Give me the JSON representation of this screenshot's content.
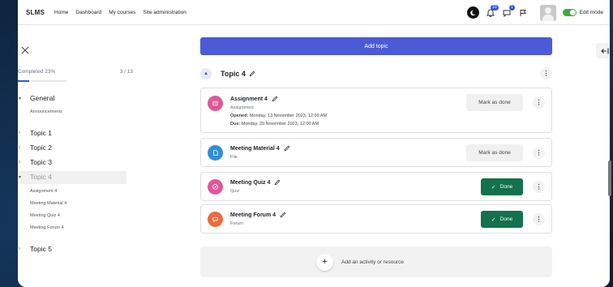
{
  "nav": {
    "brand": "SLMS",
    "links": [
      "Home",
      "Dashboard",
      "My courses",
      "Site administration"
    ],
    "notif_count": "10",
    "msg_count": "1",
    "edit_mode_label": "Edit mode",
    "edit_mode_on": true
  },
  "drawer": {
    "progress_label": "Completed 23%",
    "progress_count": "3 / 13",
    "progress_fraction": 0.23,
    "sections": [
      {
        "label": "General",
        "expanded": true,
        "children": [
          "Announcements"
        ]
      },
      {
        "label": "Topic 1",
        "expanded": false
      },
      {
        "label": "Topic 2",
        "expanded": false
      },
      {
        "label": "Topic 3",
        "expanded": false
      },
      {
        "label": "Topic 4",
        "expanded": true,
        "active": true,
        "children": [
          "Assignment 4",
          "Meeting Material 4",
          "Meeting Quiz 4",
          "Meeting Forum 4"
        ]
      },
      {
        "label": "Topic 5",
        "expanded": false
      }
    ]
  },
  "main": {
    "add_topic_label": "Add topic",
    "topic_title": "Topic 4",
    "activities": [
      {
        "title": "Assignment 4",
        "type": "Assignment",
        "opened_label": "Opened:",
        "opened": "Monday, 13 November 2023, 12:00 AM",
        "due_label": "Due:",
        "due": "Monday, 20 November 2023, 12:00 AM",
        "button": "Mark as done",
        "done": false,
        "color": "#e0589a",
        "icon": "assignment-icon"
      },
      {
        "title": "Meeting Material 4",
        "type": "File",
        "button": "Mark as done",
        "done": false,
        "color": "#2e8fd6",
        "icon": "file-icon"
      },
      {
        "title": "Meeting Quiz 4",
        "type": "Quiz",
        "button": "Done",
        "done": true,
        "color": "#e0589a",
        "icon": "quiz-icon"
      },
      {
        "title": "Meeting Forum 4",
        "type": "Forum",
        "button": "Done",
        "done": true,
        "color": "#ee6a3c",
        "icon": "forum-icon"
      }
    ],
    "add_activity_label": "Add an activity or resource"
  }
}
